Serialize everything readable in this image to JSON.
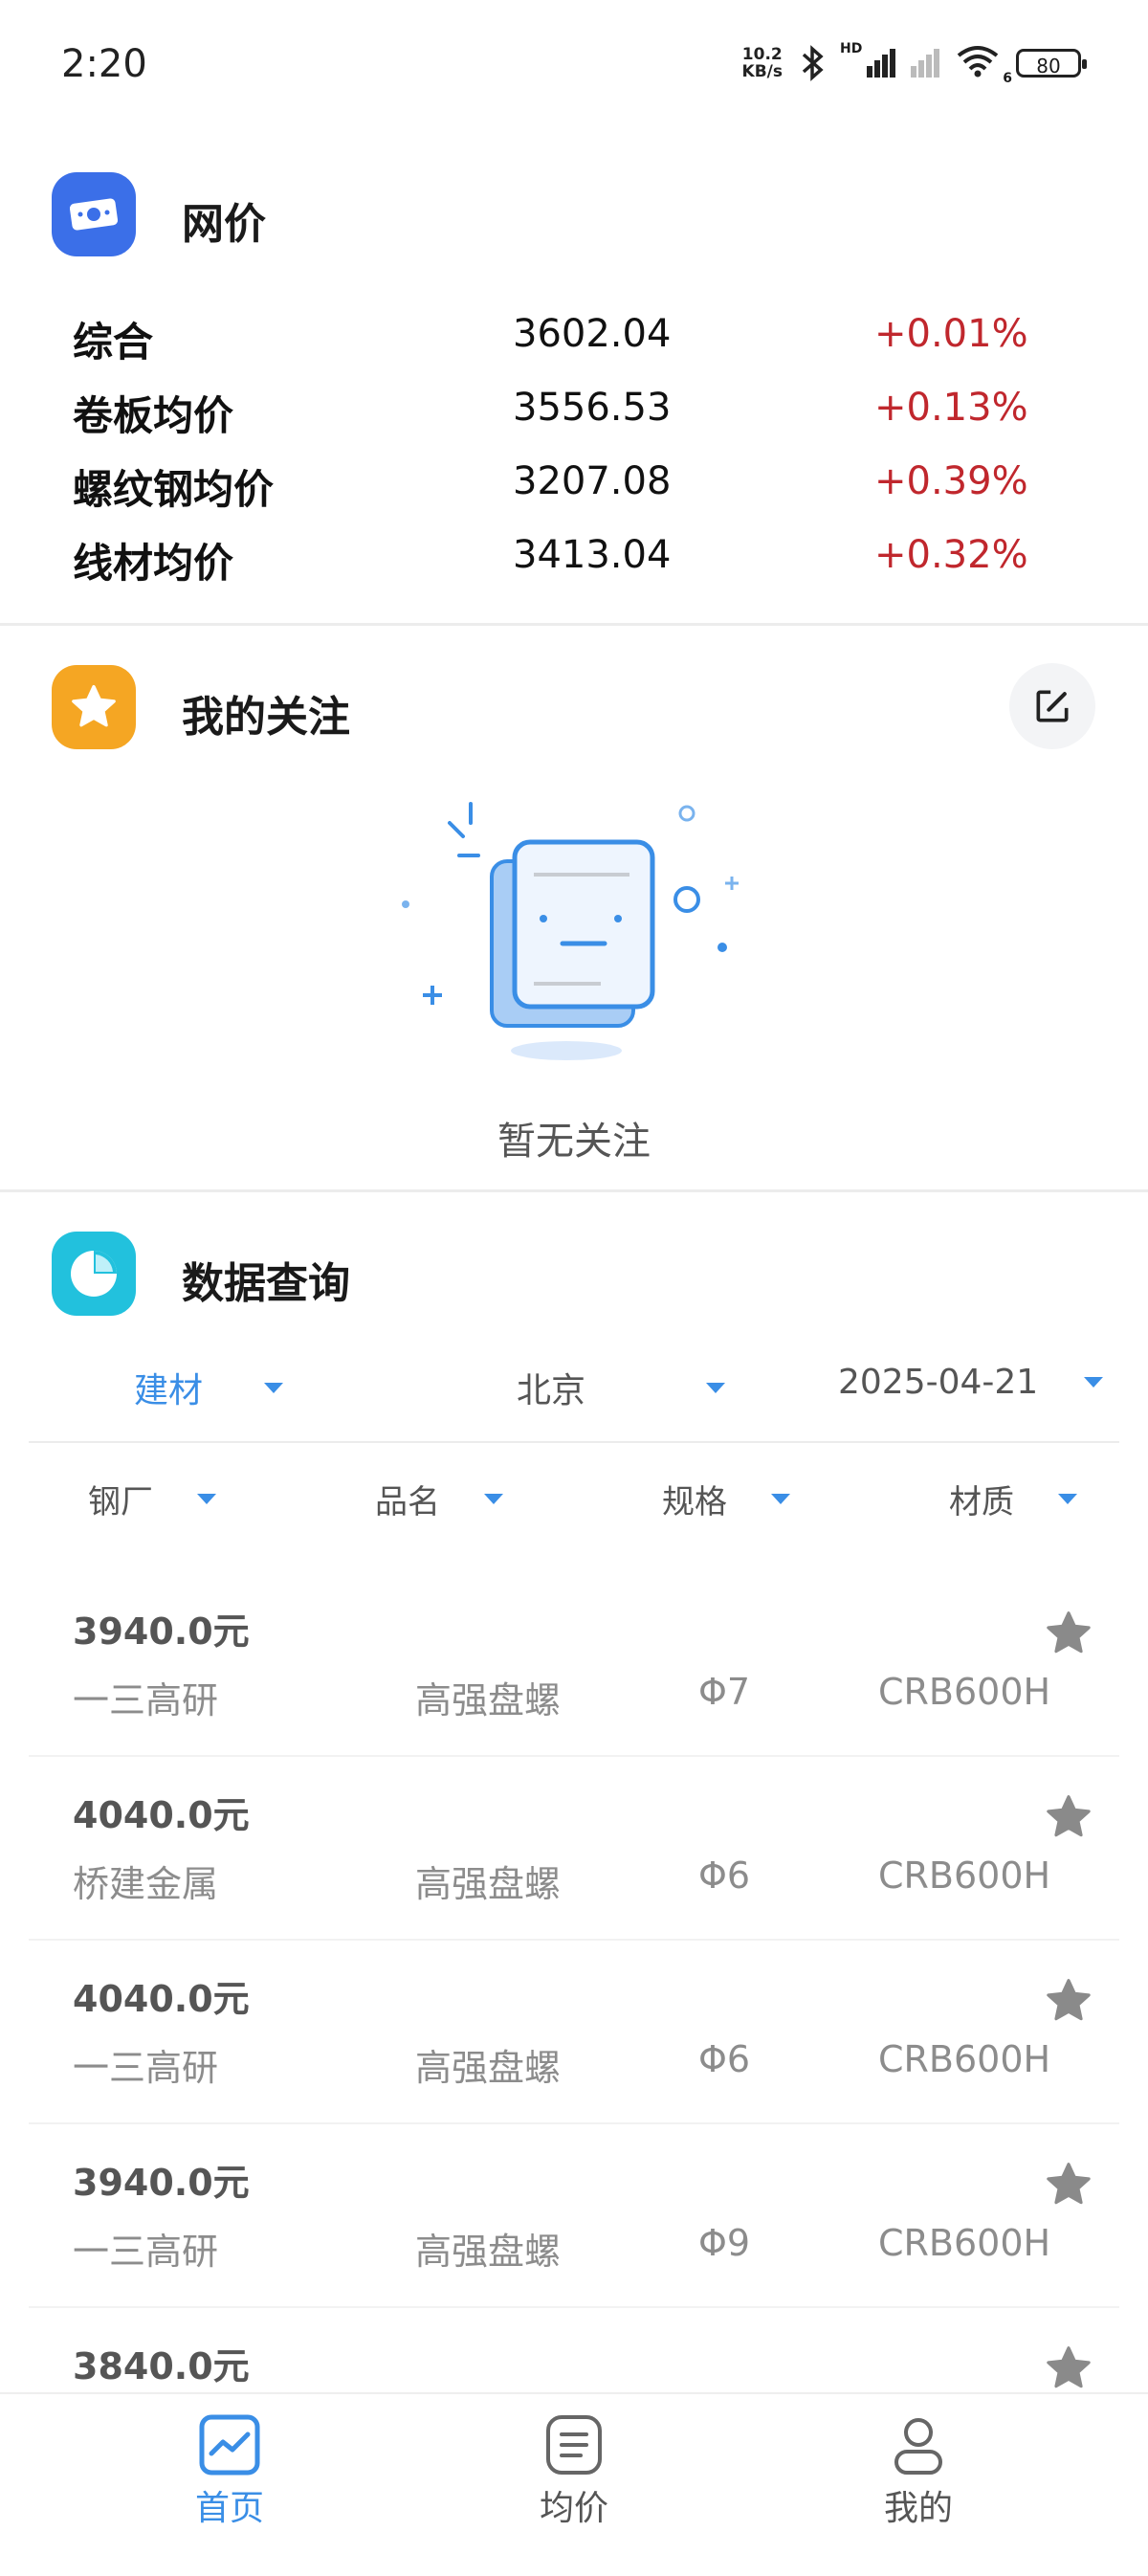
{
  "status_bar": {
    "time": "2:20",
    "net_speed_value": "10.2",
    "net_speed_unit": "KB/s",
    "hd_label": "HD",
    "wifi_sub": "6",
    "battery": "80"
  },
  "net_price": {
    "title": "网价",
    "rows": [
      {
        "name": "综合",
        "value": "3602.04",
        "change": "+0.01%"
      },
      {
        "name": "卷板均价",
        "value": "3556.53",
        "change": "+0.13%"
      },
      {
        "name": "螺纹钢均价",
        "value": "3207.08",
        "change": "+0.39%"
      },
      {
        "name": "线材均价",
        "value": "3413.04",
        "change": "+0.32%"
      }
    ]
  },
  "follow": {
    "title": "我的关注",
    "empty_text": "暂无关注"
  },
  "query": {
    "title": "数据查询",
    "filters": {
      "category": "建材",
      "city": "北京",
      "date": "2025-04-21"
    },
    "columns": [
      "钢厂",
      "品名",
      "规格",
      "材质"
    ],
    "items": [
      {
        "price": "3940.0元",
        "mill": "一三高研",
        "name": "高强盘螺",
        "spec": "Φ7",
        "material": "CRB600H"
      },
      {
        "price": "4040.0元",
        "mill": "桥建金属",
        "name": "高强盘螺",
        "spec": "Φ6",
        "material": "CRB600H"
      },
      {
        "price": "4040.0元",
        "mill": "一三高研",
        "name": "高强盘螺",
        "spec": "Φ6",
        "material": "CRB600H"
      },
      {
        "price": "3940.0元",
        "mill": "一三高研",
        "name": "高强盘螺",
        "spec": "Φ9",
        "material": "CRB600H"
      },
      {
        "price": "3840.0元",
        "mill": "",
        "name": "",
        "spec": "",
        "material": ""
      }
    ]
  },
  "bottom_nav": {
    "items": [
      {
        "label": "首页",
        "icon": "chart-icon",
        "active": true
      },
      {
        "label": "均价",
        "icon": "list-doc-icon",
        "active": false
      },
      {
        "label": "我的",
        "icon": "user-icon",
        "active": false
      }
    ]
  },
  "colors": {
    "accent": "#3a8ee6",
    "rise": "#c0272d"
  }
}
